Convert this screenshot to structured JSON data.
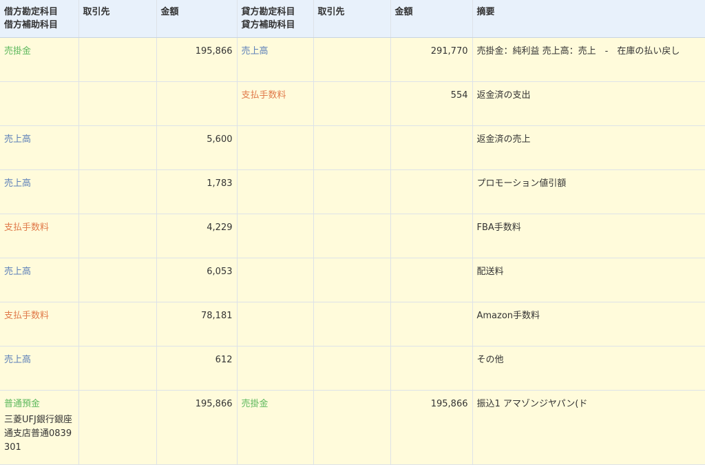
{
  "header": {
    "debit_account": "借方勘定科目",
    "debit_sub_account": "借方補助科目",
    "debit_partner": "取引先",
    "debit_amount": "金額",
    "credit_account": "貸方勘定科目",
    "credit_sub_account": "貸方補助科目",
    "credit_partner": "取引先",
    "credit_amount": "金額",
    "description": "摘要"
  },
  "colors": {
    "asset_green": "#5cb85c",
    "revenue_blue": "#5b7fb8",
    "expense_orange": "#e07a4a"
  },
  "rows": [
    {
      "debit_account": "売掛金",
      "debit_color": "#5cb85c",
      "debit_sub": "",
      "debit_partner": "",
      "debit_amount": "195,866",
      "credit_account": "売上高",
      "credit_color": "#5b7fb8",
      "credit_partner": "",
      "credit_amount": "291,770",
      "description": "売掛金：純利益 売上高：売上　-　在庫の払い戻し"
    },
    {
      "debit_account": "",
      "debit_color": "",
      "debit_sub": "",
      "debit_partner": "",
      "debit_amount": "",
      "credit_account": "支払手数料",
      "credit_color": "#e07a4a",
      "credit_partner": "",
      "credit_amount": "554",
      "description": "返金済の支出"
    },
    {
      "debit_account": "売上高",
      "debit_color": "#5b7fb8",
      "debit_sub": "",
      "debit_partner": "",
      "debit_amount": "5,600",
      "credit_account": "",
      "credit_color": "",
      "credit_partner": "",
      "credit_amount": "",
      "description": "返金済の売上"
    },
    {
      "debit_account": "売上高",
      "debit_color": "#5b7fb8",
      "debit_sub": "",
      "debit_partner": "",
      "debit_amount": "1,783",
      "credit_account": "",
      "credit_color": "",
      "credit_partner": "",
      "credit_amount": "",
      "description": "プロモーション値引額"
    },
    {
      "debit_account": "支払手数料",
      "debit_color": "#e07a4a",
      "debit_sub": "",
      "debit_partner": "",
      "debit_amount": "4,229",
      "credit_account": "",
      "credit_color": "",
      "credit_partner": "",
      "credit_amount": "",
      "description": "FBA手数料"
    },
    {
      "debit_account": "売上高",
      "debit_color": "#5b7fb8",
      "debit_sub": "",
      "debit_partner": "",
      "debit_amount": "6,053",
      "credit_account": "",
      "credit_color": "",
      "credit_partner": "",
      "credit_amount": "",
      "description": "配送料"
    },
    {
      "debit_account": "支払手数料",
      "debit_color": "#e07a4a",
      "debit_sub": "",
      "debit_partner": "",
      "debit_amount": "78,181",
      "credit_account": "",
      "credit_color": "",
      "credit_partner": "",
      "credit_amount": "",
      "description": "Amazon手数料"
    },
    {
      "debit_account": "売上高",
      "debit_color": "#5b7fb8",
      "debit_sub": "",
      "debit_partner": "",
      "debit_amount": "612",
      "credit_account": "",
      "credit_color": "",
      "credit_partner": "",
      "credit_amount": "",
      "description": "その他"
    },
    {
      "debit_account": "普通預金",
      "debit_color": "#5cb85c",
      "debit_sub": "三菱UFJ銀行銀座通支店普通0839301",
      "debit_partner": "",
      "debit_amount": "195,866",
      "credit_account": "売掛金",
      "credit_color": "#5cb85c",
      "credit_partner": "",
      "credit_amount": "195,866",
      "description": "振込1 アマゾンジヤパン(ド"
    }
  ]
}
